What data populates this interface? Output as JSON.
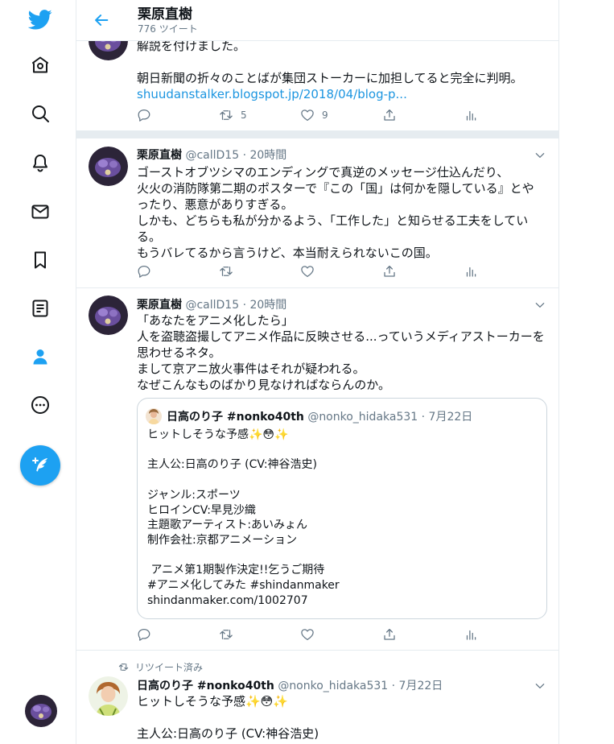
{
  "nav": {
    "items": [
      {
        "name": "twitter-logo",
        "label": "Twitter"
      },
      {
        "name": "home",
        "label": "Home"
      },
      {
        "name": "explore",
        "label": "Explore"
      },
      {
        "name": "notifications",
        "label": "Notifications"
      },
      {
        "name": "messages",
        "label": "Messages"
      },
      {
        "name": "bookmarks",
        "label": "Bookmarks"
      },
      {
        "name": "lists",
        "label": "Lists"
      },
      {
        "name": "profile",
        "label": "Profile"
      },
      {
        "name": "more",
        "label": "More"
      }
    ],
    "compose_icon": "feather-plus-icon",
    "accent": "#1da1f2"
  },
  "header": {
    "title": "栗原直樹",
    "tweet_count": "776 ツイート"
  },
  "tweets": [
    {
      "text_lines": [
        "解説を付けました。",
        "",
        "朝日新聞の折々のことばが集団ストーカーに加担してると完全に判明。"
      ],
      "link": "shuudanstalker.blogspot.jp/2018/04/blog-p...",
      "retweets": "5",
      "likes": "9"
    },
    {
      "name": "栗原直樹",
      "handle": "@callD15",
      "time": "· 20時間",
      "text": "ゴーストオブツシマのエンディングで真逆のメッセージ仕込んだり、\n火火の消防隊第二期のポスターで『この「国」は何かを隠している』とや\nったり、悪意がありすぎる。\nしかも、どちらも私が分かるよう、「工作した」と知らせる工夫をしてい\nる。\nもうバレてるから言うけど、本当耐えられないこの国。"
    },
    {
      "name": "栗原直樹",
      "handle": "@callD15",
      "time": "· 20時間",
      "text": "「あなたをアニメ化したら」\n人を盗聴盗撮してアニメ作品に反映させる...っていうメディアストーカーを\n思わせるネタ。\nまして京アニ放火事件はそれが疑われる。\nなぜこんなものばかり見なければならんのか。",
      "quote": {
        "name": "日高のり子 #nonko40th",
        "handle": "@nonko_hidaka531",
        "time": "· 7月22日",
        "text": "ヒットしそうな予感✨😳✨\n\n主人公:日高のり子 (CV:神谷浩史)\n\nジャンル:スポーツ\nヒロインCV:早見沙織\n主題歌アーティスト:あいみょん\n制作会社:京都アニメーション\n\n アニメ第1期製作決定!!乞うご期待\n#アニメ化してみた #shindanmaker\nshindanmaker.com/1002707"
      }
    },
    {
      "retweet_label": "リツイート済み",
      "name": "日高のり子 #nonko40th",
      "handle": "@nonko_hidaka531",
      "time": "· 7月22日",
      "text": "ヒットしそうな予感✨😳✨\n\n主人公:日高のり子 (CV:神谷浩史)"
    }
  ],
  "colors": {
    "brand": "#1da1f2",
    "divider": "#e6ecf0",
    "secondary_text": "#657786",
    "link": "#1b95e0"
  }
}
